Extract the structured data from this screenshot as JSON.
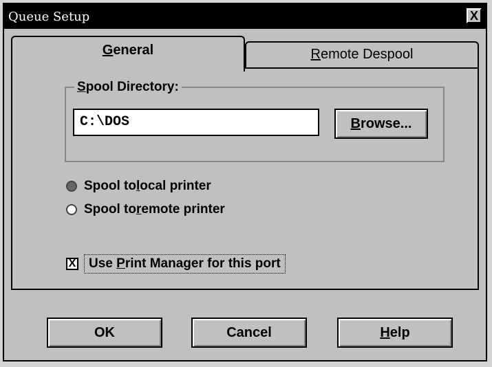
{
  "window": {
    "title": "Queue Setup",
    "close_label": "X"
  },
  "tabs": [
    {
      "pre": "",
      "u": "G",
      "post": "eneral"
    },
    {
      "pre": "",
      "u": "R",
      "post": "emote Despool"
    }
  ],
  "spool_directory": {
    "label_u": "S",
    "label_rest": "pool Directory:",
    "value": "C:\\DOS",
    "browse_u": "B",
    "browse_rest": "rowse..."
  },
  "radios": [
    {
      "pre": "Spool to ",
      "u": "l",
      "post": "ocal printer",
      "checked": true
    },
    {
      "pre": "Spool to ",
      "u": "r",
      "post": "emote printer",
      "checked": false
    }
  ],
  "checkbox": {
    "pre": "Use ",
    "u": "P",
    "post": "rint Manager for this port",
    "mark": "X"
  },
  "buttons": {
    "ok": "OK",
    "cancel": "Cancel",
    "help_u": "H",
    "help_rest": "elp"
  }
}
